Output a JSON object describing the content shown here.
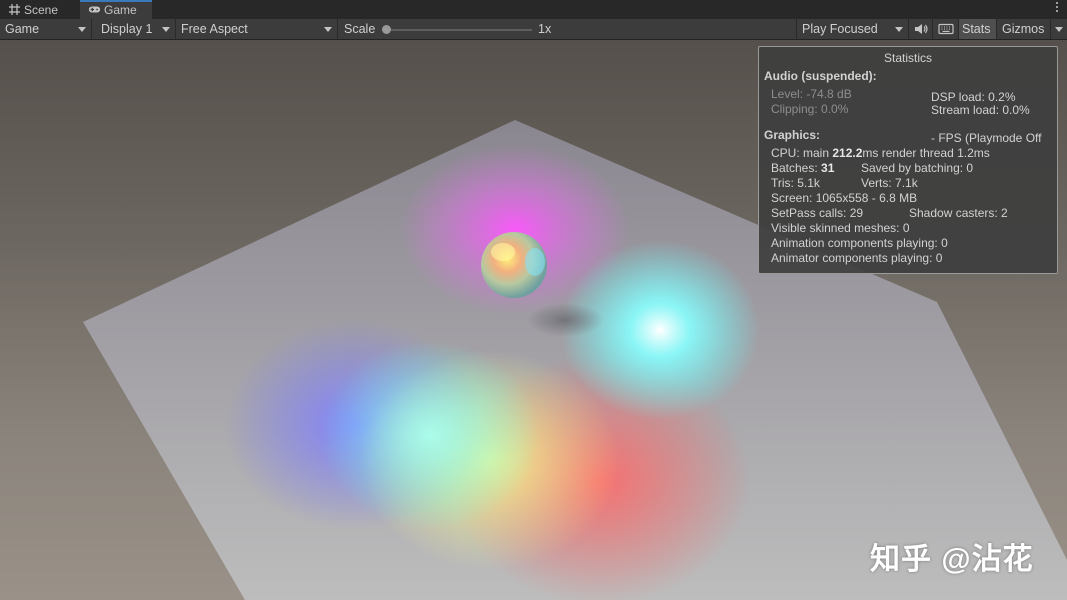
{
  "tabs": [
    {
      "label": "Scene",
      "icon": "grid-icon"
    },
    {
      "label": "Game",
      "icon": "gamepad-icon"
    }
  ],
  "toolbar": {
    "view_mode": "Game",
    "display": "Display 1",
    "aspect": "Free Aspect",
    "scale_label": "Scale",
    "scale_value": "1x",
    "scale_fraction": 0.0,
    "play_mode": "Play Focused",
    "mute_icon": "speaker-icon",
    "keyboard_icon": "keyboard-icon",
    "stats_label": "Stats",
    "gizmos_label": "Gizmos"
  },
  "stats": {
    "title": "Statistics",
    "audio_header": "Audio (suspended):",
    "level": "Level: -74.8 dB",
    "clipping": "Clipping: 0.0%",
    "dsp_load": "DSP load: 0.2%",
    "stream_load": "Stream load: 0.0%",
    "graphics_header": "Graphics:",
    "fps": "- FPS (Playmode Off",
    "cpu_prefix": "CPU: main ",
    "cpu_main": "212.2",
    "cpu_suffix": "ms  render thread 1.2ms",
    "batches_prefix": "Batches: ",
    "batches": "31",
    "saved_by_batching": "Saved by batching: 0",
    "tris": "Tris: 5.1k",
    "verts": "Verts: 7.1k",
    "screen": "Screen: 1065x558 - 6.8 MB",
    "setpass": "SetPass calls: 29",
    "shadow_casters": "Shadow casters: 2",
    "skinned": "Visible skinned meshes: 0",
    "animation": "Animation components playing: 0",
    "animator": "Animator components playing: 0"
  },
  "watermark": "知乎 @沾花",
  "colors": {
    "accent": "#3a79bb",
    "light_magenta": "#ff55ff",
    "light_cyan": "#66ffff",
    "light_blue": "#7a7aff",
    "light_yellow": "#ffff88",
    "light_red": "#ff6060"
  }
}
